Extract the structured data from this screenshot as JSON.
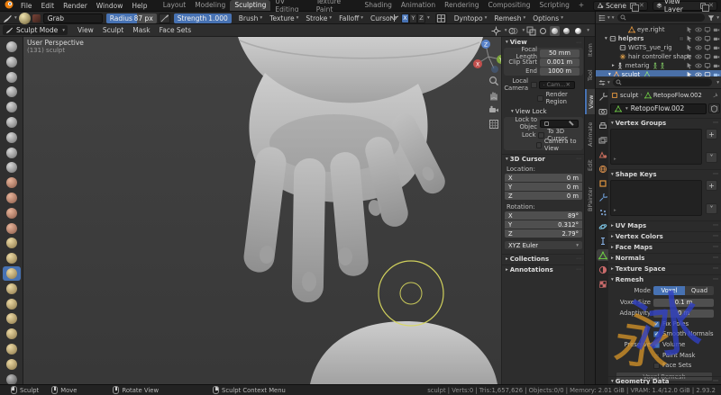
{
  "topbar": {
    "menus": [
      "File",
      "Edit",
      "Render",
      "Window",
      "Help"
    ],
    "tabs": [
      "Layout",
      "Modeling",
      "Sculpting",
      "UV Editing",
      "Texture Paint",
      "Shading",
      "Animation",
      "Rendering",
      "Compositing",
      "Scripting",
      "+"
    ],
    "scene_label": "Scene",
    "view_layer_label": "View Layer"
  },
  "tool_settings": {
    "tool_name": "Grab",
    "radius_label": "Radius",
    "radius_value": "87 px",
    "strength_label": "Strength",
    "strength_value": "1.000",
    "popovers": [
      "Brush",
      "Texture",
      "Stroke",
      "Falloff",
      "Cursor"
    ],
    "mirror_axes": [
      "X",
      "Y",
      "Z"
    ],
    "dyntopo_label": "Dyntopo",
    "remesh_label": "Remesh",
    "options_label": "Options"
  },
  "viewport_header": {
    "mode": "Sculpt Mode",
    "menus": [
      "View",
      "Sculpt",
      "Mask",
      "Face Sets"
    ]
  },
  "viewport": {
    "perspective_label": "User Perspective",
    "object_label": "(131) sculpt",
    "gizmo": {
      "x": "X",
      "y": "Y",
      "z": "Z"
    }
  },
  "npanel": {
    "tabs": [
      "Item",
      "Tool",
      "View",
      "Animate",
      "Edit",
      "BPainter"
    ],
    "view": {
      "title": "View",
      "focal_label": "Focal Length",
      "focal_value": "50 mm",
      "clip_start_label": "Clip Start",
      "clip_start_value": "0.001 m",
      "clip_end_label": "End",
      "clip_end_value": "1000 m",
      "local_camera_label": "Local Camera",
      "local_camera_value": "Cam...",
      "render_region_label": "Render Region"
    },
    "view_lock": {
      "title": "View Lock",
      "lock_to_object_label": "Lock to Objec",
      "lock_label": "Lock",
      "to_3d_cursor_label": "To 3D Cursor",
      "camera_to_view_label": "Camera to View"
    },
    "cursor": {
      "title": "3D Cursor",
      "location_label": "Location:",
      "rotation_label": "Rotation:",
      "x": "X",
      "y": "Y",
      "z": "Z",
      "loc_x": "0 m",
      "loc_y": "0 m",
      "loc_z": "0 m",
      "rot_x": "89°",
      "rot_y": "0.312°",
      "rot_z": "2.79°",
      "euler_mode": "XYZ Euler"
    },
    "collections_title": "Collections",
    "annotations_title": "Annotations"
  },
  "outliner": {
    "rows": [
      {
        "label": "eye.right"
      },
      {
        "label": "helpers"
      },
      {
        "label": "WGTS_yue_rig"
      },
      {
        "label": "hair controller shape"
      },
      {
        "label": "metarig"
      },
      {
        "label": "sculpt"
      }
    ]
  },
  "properties": {
    "breadcrumb_object": "sculpt",
    "breadcrumb_data": "RetopoFlow.002",
    "data_name": "RetopoFlow.002",
    "vertex_groups_title": "Vertex Groups",
    "shape_keys_title": "Shape Keys",
    "uv_maps_title": "UV Maps",
    "vertex_colors_title": "Vertex Colors",
    "face_maps_title": "Face Maps",
    "normals_title": "Normals",
    "texture_space_title": "Texture Space",
    "remesh_title": "Remesh",
    "geometry_data_title": "Geometry Data",
    "remesh": {
      "mode_label": "Mode",
      "voxel": "Voxel",
      "quad": "Quad",
      "voxel_size_label": "Voxel Size",
      "voxel_size_value": "0.1 m",
      "adaptivity_label": "Adaptivity",
      "adaptivity_value": "0 m",
      "fix_poles_label": "Fix Poles",
      "fix_poles_checked": true,
      "smooth_normals_label": "Smooth Normals",
      "smooth_normals_checked": true,
      "preserve_label": "Preserve",
      "volume_label": "Volume",
      "volume_checked": true,
      "paint_mask_label": "Paint Mask",
      "paint_mask_checked": false,
      "face_sets_label": "Face Sets",
      "face_sets_checked": false,
      "voxel_remesh_button": "Voxel Remesh"
    }
  },
  "statusbar": {
    "hints": [
      {
        "button": "left",
        "label": "Sculpt"
      },
      {
        "button": "middle",
        "label": "Move"
      },
      {
        "button": "middle",
        "label": "Rotate View"
      },
      {
        "button": "right",
        "label": "Sculpt Context Menu"
      }
    ],
    "stats": "sculpt | Verts:0 | Tris:1,657,626 | Objects:0/0 | Memory: 2.01 GiB | VRAM: 1.4/12.0 GiB | 2.93.2"
  },
  "colors": {
    "accent": "#4772b3",
    "selection": "#4a70a8",
    "brush_cursor": "#d8d85e"
  }
}
